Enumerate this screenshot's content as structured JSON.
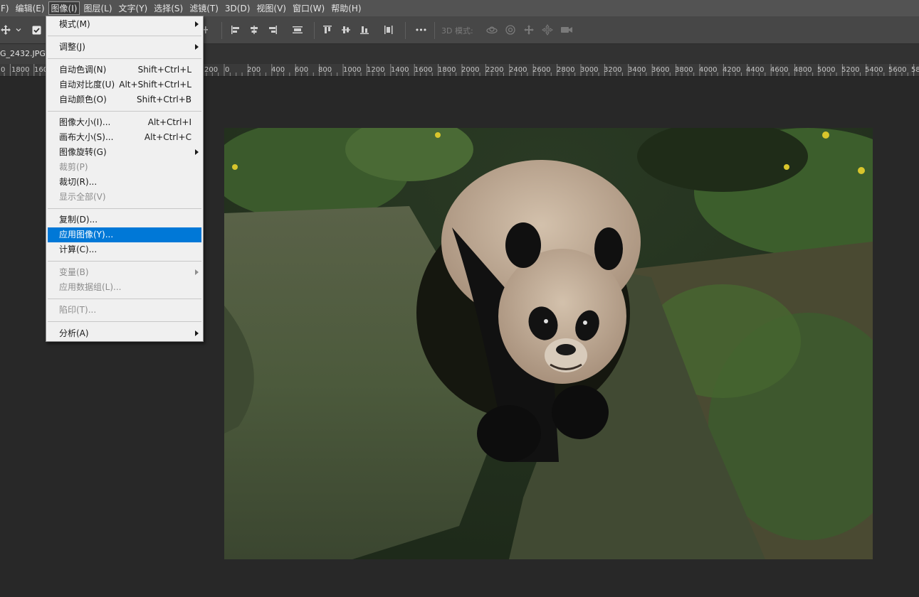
{
  "menubar": {
    "items": [
      {
        "label": "F)",
        "active": false
      },
      {
        "label": "编辑(E)",
        "active": false
      },
      {
        "label": "图像(I)",
        "active": true
      },
      {
        "label": "图层(L)",
        "active": false
      },
      {
        "label": "文字(Y)",
        "active": false
      },
      {
        "label": "选择(S)",
        "active": false
      },
      {
        "label": "滤镜(T)",
        "active": false
      },
      {
        "label": "3D(D)",
        "active": false
      },
      {
        "label": "视图(V)",
        "active": false
      },
      {
        "label": "窗口(W)",
        "active": false
      },
      {
        "label": "帮助(H)",
        "active": false
      }
    ]
  },
  "optbar": {
    "mode_3d_label": "3D 模式:",
    "more_label": "•••"
  },
  "document": {
    "tab_label": "G_2432.JPG"
  },
  "ruler": {
    "left_labels": [
      "0",
      "1800",
      "160"
    ],
    "labels": [
      "200",
      "0",
      "200",
      "400",
      "600",
      "800",
      "1000",
      "1200",
      "1400",
      "1600",
      "1800",
      "2000",
      "2200",
      "2400",
      "2600",
      "2800",
      "3000",
      "3200",
      "3400",
      "3600",
      "3800",
      "4000",
      "4200",
      "4400",
      "4600",
      "4800",
      "5000",
      "5200",
      "5400",
      "5600",
      "58"
    ]
  },
  "image_menu": {
    "items": [
      {
        "label": "模式(M)",
        "shortcut": "",
        "submenu": true,
        "disabled": false,
        "highlighted": false
      },
      {
        "label": "调整(J)",
        "shortcut": "",
        "submenu": true,
        "disabled": false,
        "highlighted": false
      },
      {
        "label": "自动色调(N)",
        "shortcut": "Shift+Ctrl+L",
        "submenu": false,
        "disabled": false,
        "highlighted": false
      },
      {
        "label": "自动对比度(U)",
        "shortcut": "Alt+Shift+Ctrl+L",
        "submenu": false,
        "disabled": false,
        "highlighted": false
      },
      {
        "label": "自动颜色(O)",
        "shortcut": "Shift+Ctrl+B",
        "submenu": false,
        "disabled": false,
        "highlighted": false
      },
      {
        "label": "图像大小(I)...",
        "shortcut": "Alt+Ctrl+I",
        "submenu": false,
        "disabled": false,
        "highlighted": false
      },
      {
        "label": "画布大小(S)...",
        "shortcut": "Alt+Ctrl+C",
        "submenu": false,
        "disabled": false,
        "highlighted": false
      },
      {
        "label": "图像旋转(G)",
        "shortcut": "",
        "submenu": true,
        "disabled": false,
        "highlighted": false
      },
      {
        "label": "裁剪(P)",
        "shortcut": "",
        "submenu": false,
        "disabled": true,
        "highlighted": false
      },
      {
        "label": "裁切(R)...",
        "shortcut": "",
        "submenu": false,
        "disabled": false,
        "highlighted": false
      },
      {
        "label": "显示全部(V)",
        "shortcut": "",
        "submenu": false,
        "disabled": true,
        "highlighted": false
      },
      {
        "label": "复制(D)...",
        "shortcut": "",
        "submenu": false,
        "disabled": false,
        "highlighted": false
      },
      {
        "label": "应用图像(Y)...",
        "shortcut": "",
        "submenu": false,
        "disabled": false,
        "highlighted": true
      },
      {
        "label": "计算(C)...",
        "shortcut": "",
        "submenu": false,
        "disabled": false,
        "highlighted": false
      },
      {
        "label": "变量(B)",
        "shortcut": "",
        "submenu": true,
        "disabled": true,
        "highlighted": false
      },
      {
        "label": "应用数据组(L)...",
        "shortcut": "",
        "submenu": false,
        "disabled": true,
        "highlighted": false
      },
      {
        "label": "陷印(T)...",
        "shortcut": "",
        "submenu": false,
        "disabled": true,
        "highlighted": false
      },
      {
        "label": "分析(A)",
        "shortcut": "",
        "submenu": true,
        "disabled": false,
        "highlighted": false
      }
    ]
  },
  "colors": {
    "menubar_bg": "#535353",
    "optbar_bg": "#474747",
    "canvas_bg": "#282828",
    "menu_bg": "#f0f0f0",
    "highlight": "#0078d7",
    "disabled_text": "#8d8d8d"
  }
}
